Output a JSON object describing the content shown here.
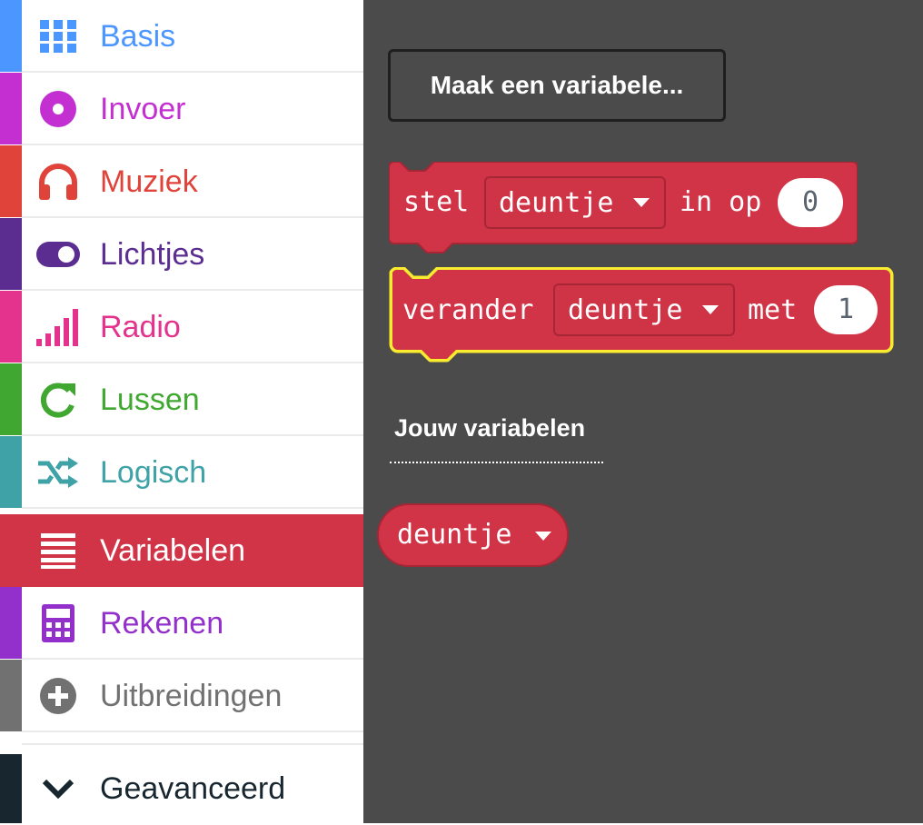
{
  "colors": {
    "basis": "#4c97ff",
    "invoer": "#c32fd1",
    "muziek": "#e0433a",
    "lichtjes": "#5c2d91",
    "radio": "#e3338c",
    "lussen": "#40a830",
    "logisch": "#3fa2a7",
    "variabelen": "#d13447",
    "rekenen": "#9330cb",
    "uitbreidingen": "#717171",
    "geavanceerd": "#17262f",
    "workspace": "#4c4b4c",
    "highlight": "#f9ec2f"
  },
  "sidebar": {
    "categories": [
      {
        "label": "Basis",
        "icon": "grid-icon"
      },
      {
        "label": "Invoer",
        "icon": "circle-target-icon"
      },
      {
        "label": "Muziek",
        "icon": "headphones-icon"
      },
      {
        "label": "Lichtjes",
        "icon": "toggle-icon"
      },
      {
        "label": "Radio",
        "icon": "signal-bars-icon"
      },
      {
        "label": "Lussen",
        "icon": "refresh-icon"
      },
      {
        "label": "Logisch",
        "icon": "shuffle-icon"
      },
      {
        "label": "Variabelen",
        "icon": "lines-icon",
        "active": true
      },
      {
        "label": "Rekenen",
        "icon": "calculator-icon"
      },
      {
        "label": "Uitbreidingen",
        "icon": "plus-circle-icon"
      }
    ],
    "advanced": {
      "label": "Geavanceerd",
      "icon": "chevron-down-icon"
    }
  },
  "workspace": {
    "make_variable_button": "Maak een variabele...",
    "set_block": {
      "prefix": "stel",
      "variable": "deuntje",
      "middle": "in op",
      "value": "0"
    },
    "change_block": {
      "prefix": "verander",
      "variable": "deuntje",
      "middle": "met",
      "value": "1"
    },
    "your_variables_label": "Jouw variabelen",
    "variable_reporter": "deuntje"
  }
}
